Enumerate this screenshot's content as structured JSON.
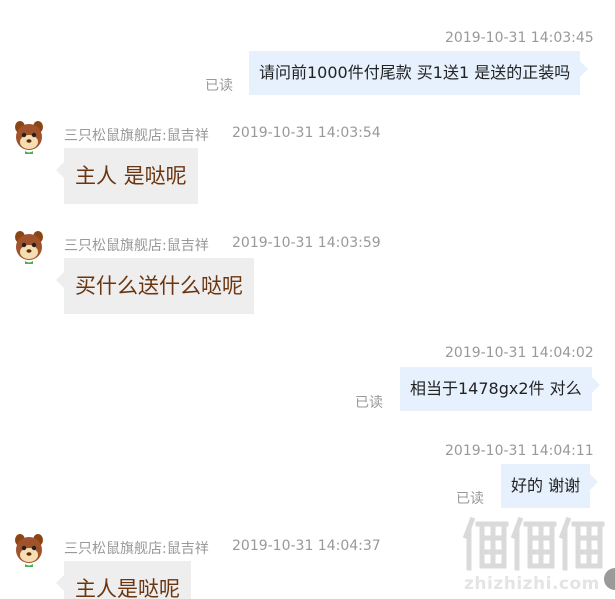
{
  "conversation": {
    "messages": [
      {
        "direction": "outgoing",
        "timestamp": "2019-10-31 14:03:45",
        "text": "请问前1000件付尾款  买1送1  是送的正装吗",
        "status": "已读"
      },
      {
        "direction": "incoming",
        "sender": "三只松鼠旗舰店:鼠吉祥",
        "timestamp": "2019-10-31 14:03:54",
        "text": "主人    是哒呢"
      },
      {
        "direction": "incoming",
        "sender": "三只松鼠旗舰店:鼠吉祥",
        "timestamp": "2019-10-31 14:03:59",
        "text": "买什么送什么哒呢"
      },
      {
        "direction": "outgoing",
        "timestamp": "2019-10-31 14:04:02",
        "text": "相当于1478gx2件  对么",
        "status": "已读"
      },
      {
        "direction": "outgoing",
        "timestamp": "2019-10-31 14:04:11",
        "text": "好的  谢谢",
        "status": "已读"
      },
      {
        "direction": "incoming",
        "sender": "三只松鼠旗舰店:鼠吉祥",
        "timestamp": "2019-10-31 14:04:37",
        "text": "主人是哒呢"
      }
    ]
  },
  "watermark": {
    "text": "zhizhizhi.com"
  },
  "icons": {
    "avatar": "squirrel-avatar-icon"
  },
  "colors": {
    "outgoing_bubble": "#e6f1fd",
    "incoming_bubble": "#eeeeee",
    "incoming_text": "#6b3510",
    "meta_text": "#999999"
  }
}
